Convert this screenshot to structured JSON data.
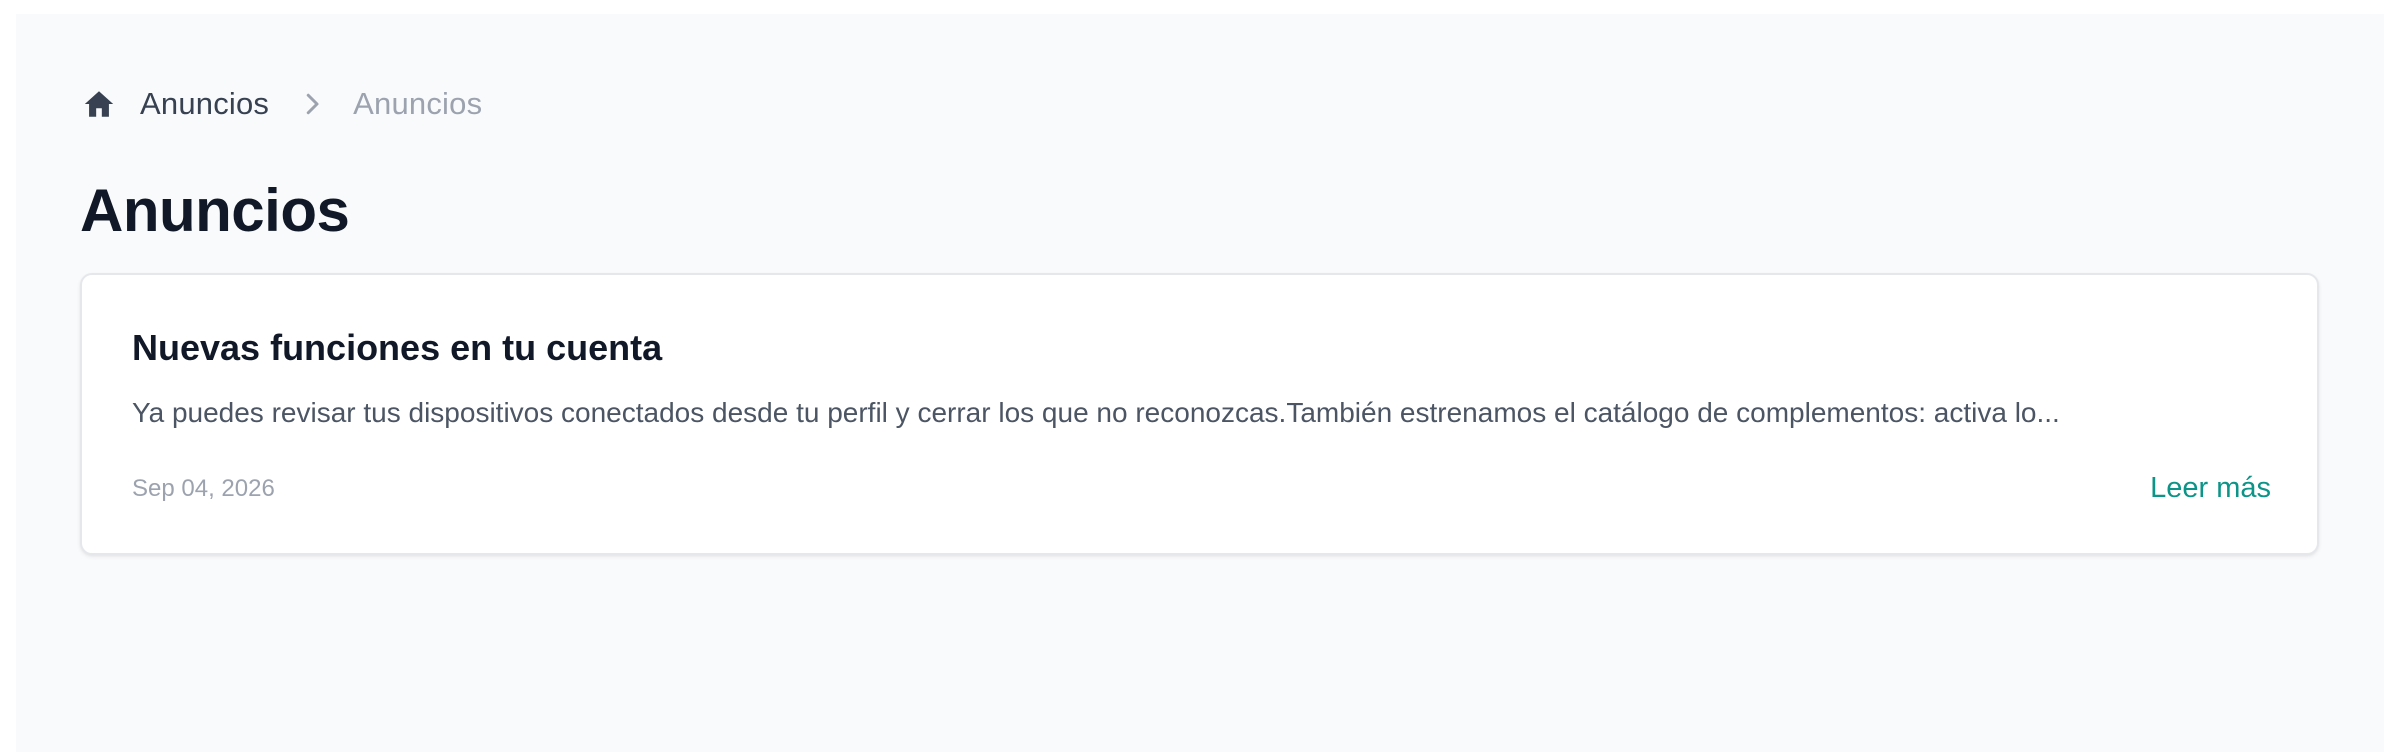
{
  "breadcrumb": {
    "home_icon": "home-icon",
    "home_label": "Anuncios",
    "separator_icon": "chevron-right-icon",
    "current_label": "Anuncios"
  },
  "page": {
    "title": "Anuncios"
  },
  "announcements": [
    {
      "title": "Nuevas funciones en tu cuenta",
      "excerpt": "Ya puedes revisar tus dispositivos conectados desde tu perfil y cerrar los que no reconozcas.También estrenamos el catálogo de complementos: activa lo...",
      "date": "Sep 04, 2026",
      "read_more_label": "Leer más"
    }
  ],
  "colors": {
    "background": "#f9fafb",
    "card": "#ffffff",
    "accent": "#0d9488",
    "title": "#111827",
    "muted": "#9ca3af"
  }
}
